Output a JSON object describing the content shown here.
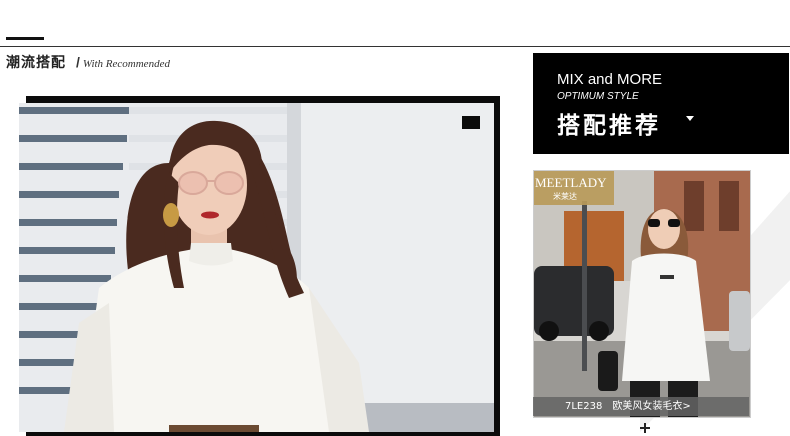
{
  "section": {
    "title": "潮流搭配",
    "subtitle": "With Recommended"
  },
  "promo": {
    "title": "MIX and MORE",
    "subtitle": "OPTIMUM STYLE",
    "cn_label": "搭配推荐"
  },
  "product": {
    "brand_en": "MEETLADY",
    "brand_cn": "米莱达",
    "code": "7LE238",
    "name": "欧美风女装毛衣",
    "arrow": ">"
  },
  "colors": {
    "accent": "#000000",
    "caption_bg": "#646464",
    "brand_box": "#b99a5a"
  }
}
